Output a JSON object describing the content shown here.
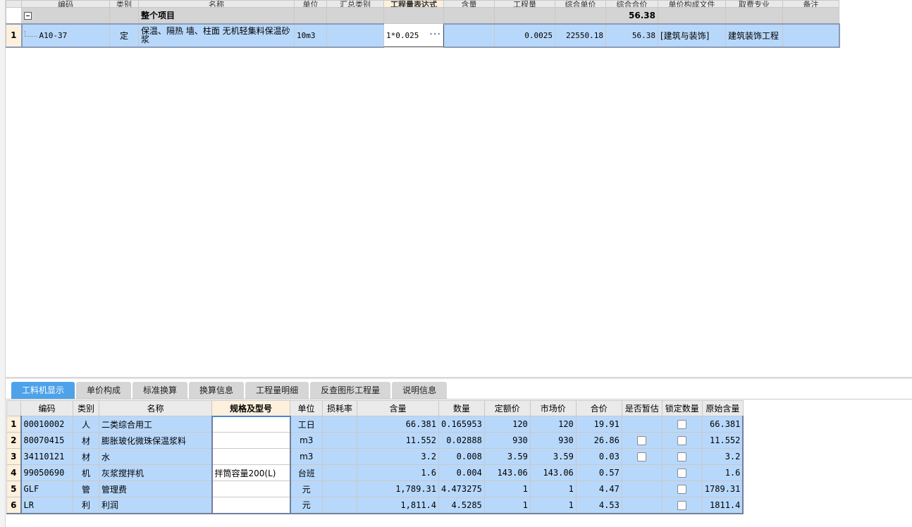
{
  "top_grid": {
    "headers": [
      "编码",
      "类别",
      "名称",
      "单位",
      "汇总类别",
      "工程量表达式",
      "含量",
      "工程量",
      "综合单价",
      "综合合价",
      "单价构成文件",
      "取费专业",
      "备注"
    ],
    "group_row": {
      "label": "整个项目",
      "total": "56.38"
    },
    "rows": [
      {
        "num": "1",
        "code": "A10-37",
        "category": "定",
        "name": "保温、隔热 墙、柱面 无机轻集料保温砂浆",
        "unit": "10m3",
        "summary_type": "",
        "expression": "1*0.025",
        "content": "",
        "quantity": "0.0025",
        "unit_price": "22550.18",
        "total_price": "56.38",
        "price_file": "[建筑与装饰]",
        "fee_specialty": "建筑装饰工程",
        "note": ""
      }
    ]
  },
  "tabs": [
    {
      "label": "工料机显示",
      "active": true
    },
    {
      "label": "单价构成",
      "active": false
    },
    {
      "label": "标准换算",
      "active": false
    },
    {
      "label": "换算信息",
      "active": false
    },
    {
      "label": "工程量明细",
      "active": false
    },
    {
      "label": "反查图形工程量",
      "active": false
    },
    {
      "label": "说明信息",
      "active": false
    }
  ],
  "bottom_grid": {
    "headers": [
      "编码",
      "类别",
      "名称",
      "规格及型号",
      "单位",
      "损耗率",
      "含量",
      "数量",
      "定额价",
      "市场价",
      "合价",
      "是否暂估",
      "锁定数量",
      "原始含量"
    ],
    "rows": [
      {
        "num": "1",
        "code": "00010002",
        "category": "人",
        "name": "二类综合用工",
        "spec": "",
        "unit": "工日",
        "loss": "",
        "content": "66.381",
        "qty": "0.165953",
        "quota_price": "120",
        "market_price": "120",
        "total": "19.91",
        "estimate": false,
        "estimate_cb": false,
        "lock_cb": true,
        "orig": "66.381"
      },
      {
        "num": "2",
        "code": "80070415",
        "category": "材",
        "name": "膨胀玻化微珠保温浆料",
        "spec": "",
        "unit": "m3",
        "loss": "",
        "content": "11.552",
        "qty": "0.02888",
        "quota_price": "930",
        "market_price": "930",
        "total": "26.86",
        "estimate_cb": true,
        "lock_cb": true,
        "orig": "11.552"
      },
      {
        "num": "3",
        "code": "34110121",
        "category": "材",
        "name": "水",
        "spec": "",
        "unit": "m3",
        "loss": "",
        "content": "3.2",
        "qty": "0.008",
        "quota_price": "3.59",
        "market_price": "3.59",
        "total": "0.03",
        "estimate_cb": true,
        "lock_cb": true,
        "orig": "3.2"
      },
      {
        "num": "4",
        "code": "99050690",
        "category": "机",
        "name": "灰浆搅拌机",
        "spec": "拌筒容量200(L)",
        "unit": "台班",
        "loss": "",
        "content": "1.6",
        "qty": "0.004",
        "quota_price": "143.06",
        "market_price": "143.06",
        "total": "0.57",
        "estimate_cb": false,
        "lock_cb": true,
        "orig": "1.6"
      },
      {
        "num": "5",
        "code": "GLF",
        "category": "管",
        "name": "管理费",
        "spec": "",
        "unit": "元",
        "loss": "",
        "content": "1,789.31",
        "qty": "4.473275",
        "quota_price": "1",
        "market_price": "1",
        "total": "4.47",
        "estimate_cb": false,
        "lock_cb": true,
        "orig": "1789.31"
      },
      {
        "num": "6",
        "code": "LR",
        "category": "利",
        "name": "利润",
        "spec": "",
        "unit": "元",
        "loss": "",
        "content": "1,811.4",
        "qty": "4.5285",
        "quota_price": "1",
        "market_price": "1",
        "total": "4.53",
        "estimate_cb": false,
        "lock_cb": true,
        "orig": "1811.4"
      }
    ]
  },
  "icons": {
    "collapse": "minus-box-icon",
    "expression_more": "ellipsis-icon",
    "checkbox": "checkbox-icon"
  }
}
